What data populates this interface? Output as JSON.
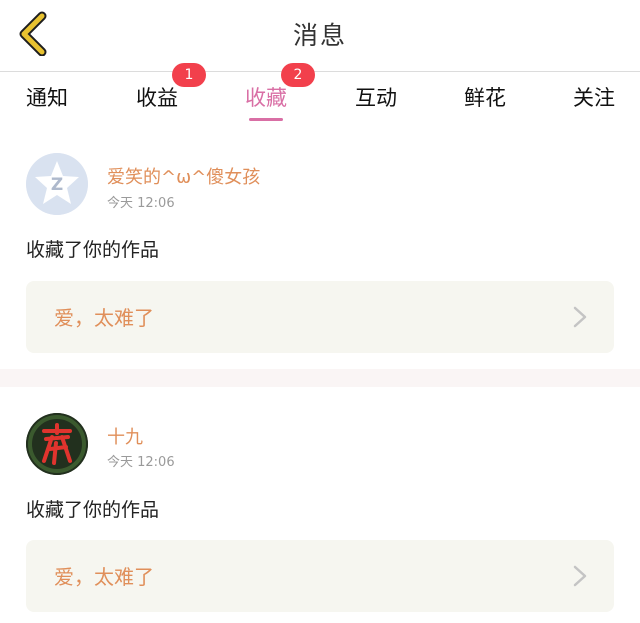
{
  "header": {
    "title": "消息"
  },
  "tabs": [
    {
      "label": "通知",
      "badge": ""
    },
    {
      "label": "收益",
      "badge": "1"
    },
    {
      "label": "收藏",
      "badge": "2",
      "active": true
    },
    {
      "label": "互动",
      "badge": ""
    },
    {
      "label": "鲜花",
      "badge": ""
    },
    {
      "label": "关注",
      "badge": ""
    }
  ],
  "messages": [
    {
      "user": "爱笑的^ω^傻女孩",
      "time": "今天 12:06",
      "action": "收藏了你的作品",
      "work_title": "爱，太难了",
      "avatar_icon": "qq-icon"
    },
    {
      "user": "十九",
      "time": "今天 12:06",
      "action": "收藏了你的作品",
      "work_title": "爱，太难了",
      "avatar_icon": "ye-calligraphy-avatar"
    }
  ],
  "colors": {
    "accent": "#d96fa5",
    "badge": "#f2404c",
    "work_title": "#e08f5a",
    "back_arrow": "#e8c230"
  }
}
